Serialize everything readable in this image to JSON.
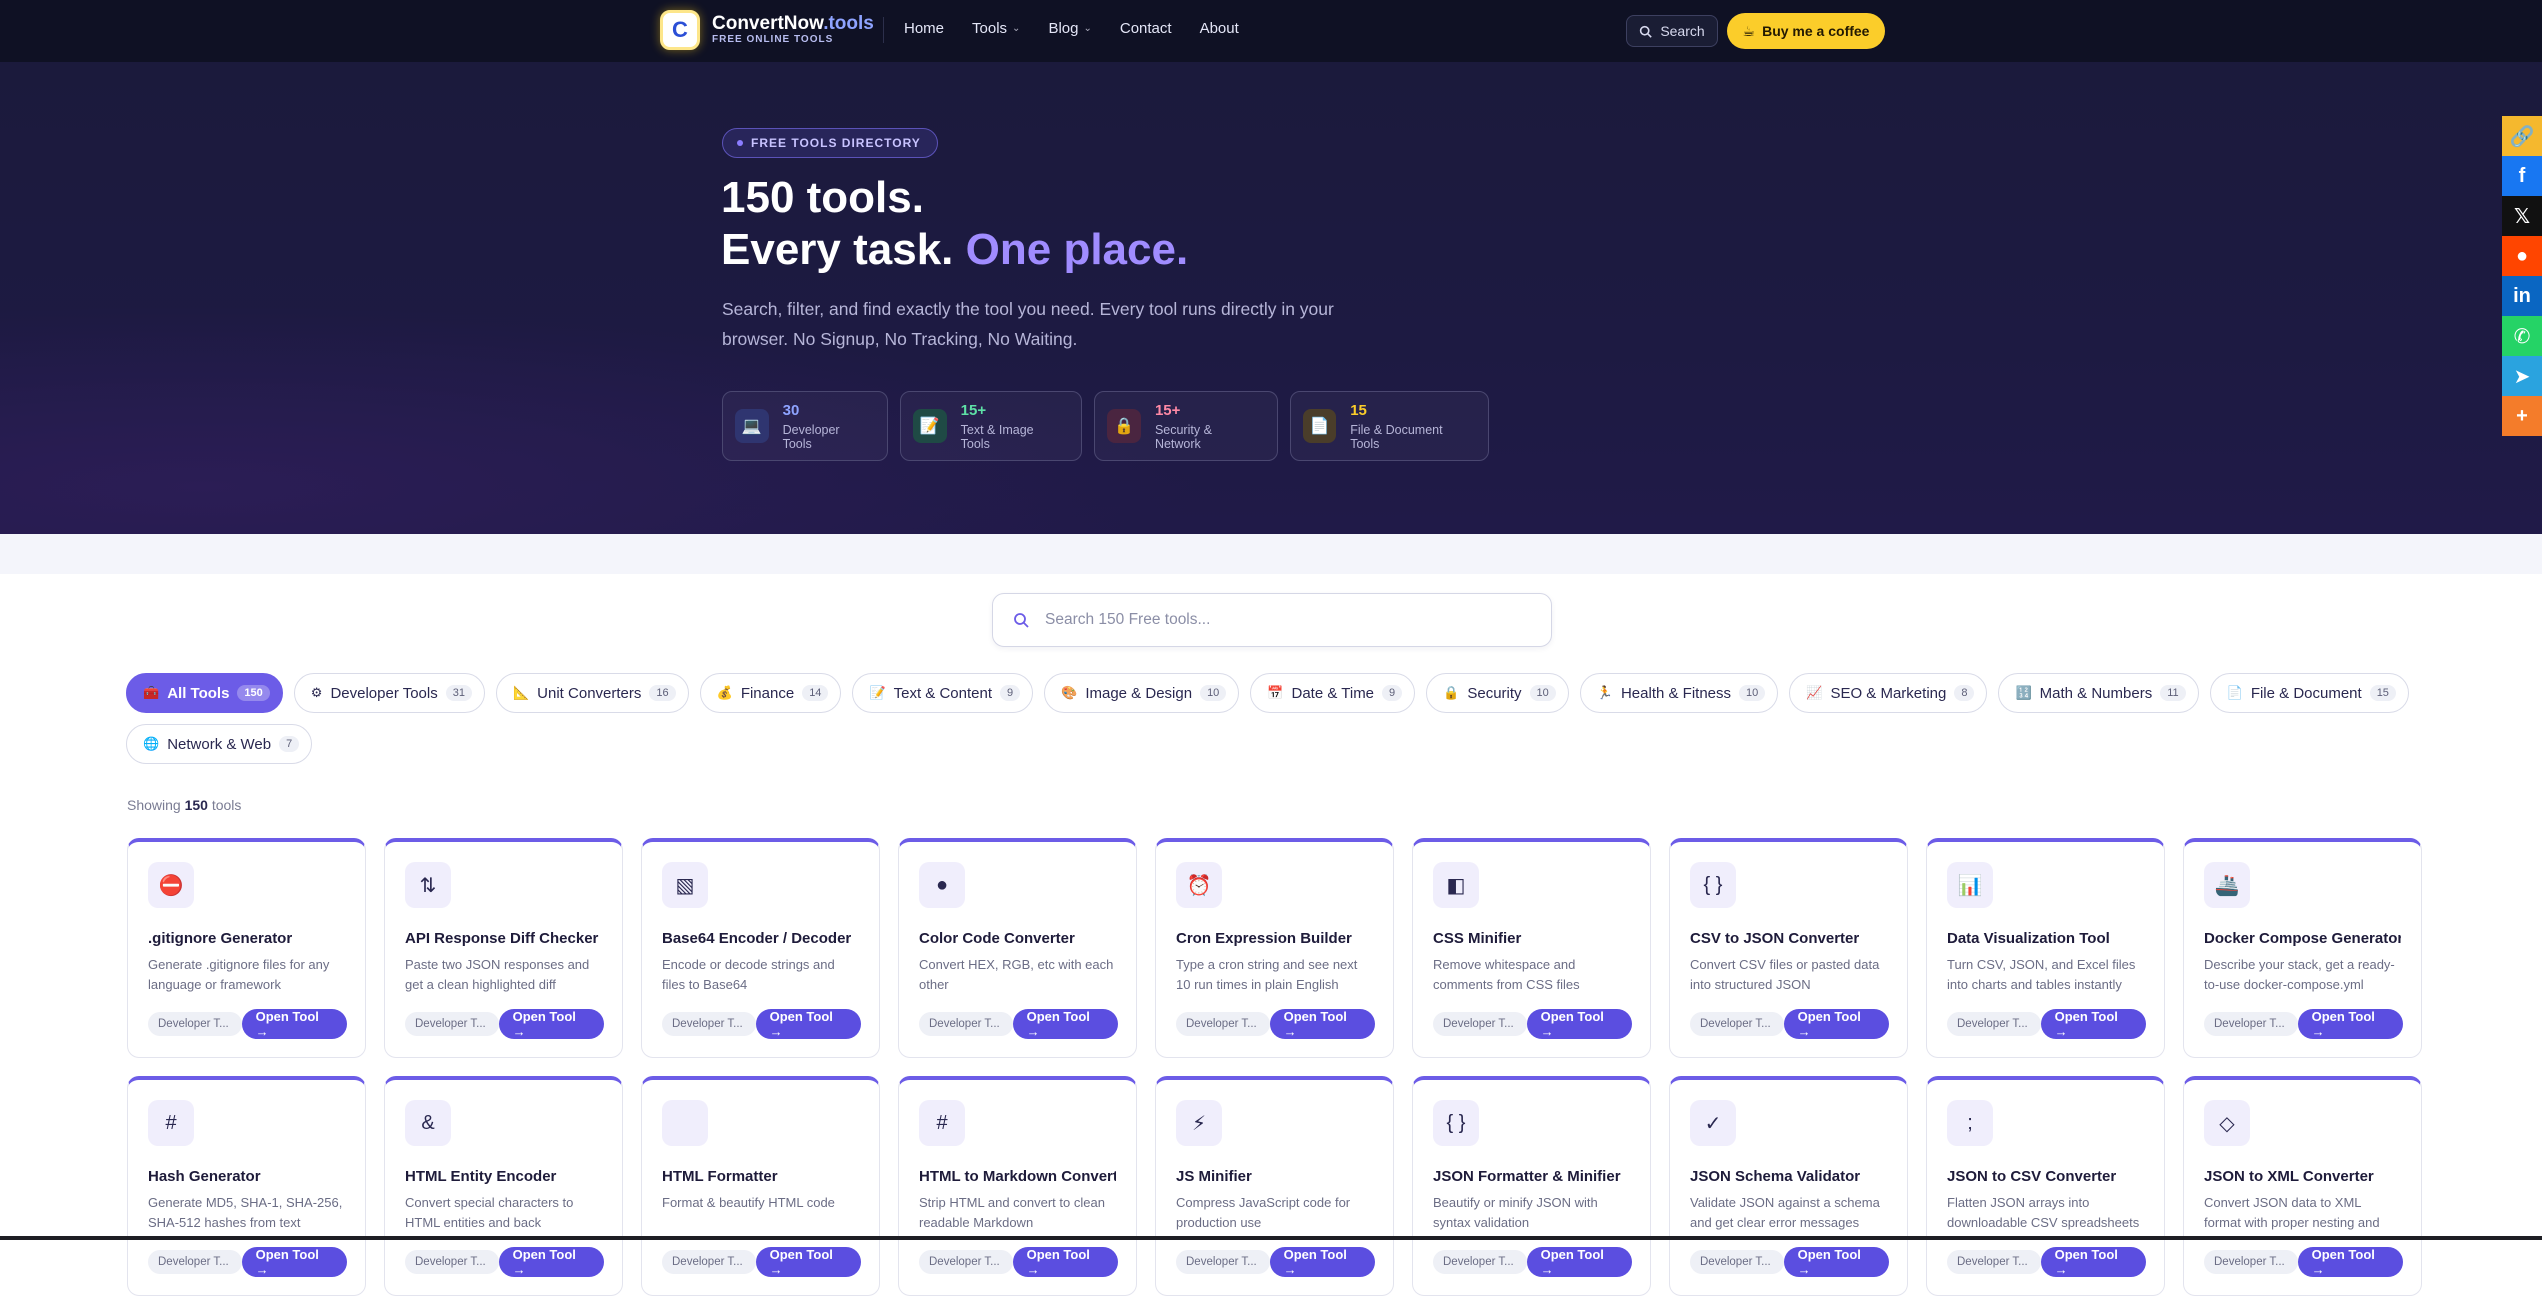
{
  "nav": {
    "brand_name": "ConvertNow",
    "brand_tld": ".tools",
    "brand_sub": "FREE ONLINE TOOLS",
    "logo_letter": "C",
    "links": [
      {
        "label": "Home"
      },
      {
        "label": "Tools",
        "dropdown": true
      },
      {
        "label": "Blog",
        "dropdown": true
      },
      {
        "label": "Contact"
      },
      {
        "label": "About"
      }
    ],
    "search_label": "Search",
    "coffee_label": "Buy me a coffee"
  },
  "hero": {
    "badge": "FREE TOOLS DIRECTORY",
    "title_line1": "150 tools.",
    "title_line2_plain": "Every task.",
    "title_line2_accent": "One place.",
    "description": "Search, filter, and find exactly the tool you need. Every tool runs directly in your browser. No Signup, No Tracking, No Waiting.",
    "stats": [
      {
        "number": "30",
        "label": "Developer Tools",
        "icon": "💻",
        "color": "#8ea3ff",
        "bg": "#2f3570"
      },
      {
        "number": "15+",
        "label": "Text & Image Tools",
        "icon": "📝",
        "color": "#5ee1a6",
        "bg": "#1f4a45"
      },
      {
        "number": "15+",
        "label": "Security & Network",
        "icon": "🔒",
        "color": "#ff8aa6",
        "bg": "#4a2540"
      },
      {
        "number": "15",
        "label": "File & Document Tools",
        "icon": "📄",
        "color": "#fbcd2a",
        "bg": "#4a3d2a"
      }
    ]
  },
  "share": [
    {
      "icon": "link-icon",
      "glyph": "🔗",
      "color": "#f5b82e"
    },
    {
      "icon": "facebook-icon",
      "glyph": "f",
      "color": "#1877f2"
    },
    {
      "icon": "x-icon",
      "glyph": "𝕏",
      "color": "#111111"
    },
    {
      "icon": "reddit-icon",
      "glyph": "●",
      "color": "#ff4500"
    },
    {
      "icon": "linkedin-icon",
      "glyph": "in",
      "color": "#0a66c2"
    },
    {
      "icon": "whatsapp-icon",
      "glyph": "✆",
      "color": "#25d366"
    },
    {
      "icon": "telegram-icon",
      "glyph": "➤",
      "color": "#2aa3df"
    },
    {
      "icon": "more-icon",
      "glyph": "+",
      "color": "#f47c2a"
    }
  ],
  "search": {
    "placeholder": "Search 150 Free tools..."
  },
  "filters": [
    {
      "label": "All Tools",
      "count": "150",
      "icon": "🧰",
      "active": true
    },
    {
      "label": "Developer Tools",
      "count": "31",
      "icon": "⚙"
    },
    {
      "label": "Unit Converters",
      "count": "16",
      "icon": "📐"
    },
    {
      "label": "Finance",
      "count": "14",
      "icon": "💰"
    },
    {
      "label": "Text & Content",
      "count": "9",
      "icon": "📝"
    },
    {
      "label": "Image & Design",
      "count": "10",
      "icon": "🎨"
    },
    {
      "label": "Date & Time",
      "count": "9",
      "icon": "📅"
    },
    {
      "label": "Security",
      "count": "10",
      "icon": "🔒"
    },
    {
      "label": "Health & Fitness",
      "count": "10",
      "icon": "🏃"
    },
    {
      "label": "SEO & Marketing",
      "count": "8",
      "icon": "📈"
    },
    {
      "label": "Math & Numbers",
      "count": "11",
      "icon": "🔢"
    },
    {
      "label": "File & Document",
      "count": "15",
      "icon": "📄"
    },
    {
      "label": "Network & Web",
      "count": "7",
      "icon": "🌐"
    }
  ],
  "showing": {
    "prefix": "Showing",
    "count": "150",
    "suffix": "tools"
  },
  "cards": [
    {
      "icon": "⛔",
      "title": ".gitignore Generator",
      "desc": "Generate .gitignore files for any language or framework",
      "tag": "Developer T...",
      "cta": "Open Tool →"
    },
    {
      "icon": "⇅",
      "title": "API Response Diff Checker",
      "desc": "Paste two JSON responses and get a clean highlighted diff",
      "tag": "Developer T...",
      "cta": "Open Tool →"
    },
    {
      "icon": "▧",
      "title": "Base64 Encoder / Decoder",
      "desc": "Encode or decode strings and files to Base64",
      "tag": "Developer T...",
      "cta": "Open Tool →"
    },
    {
      "icon": "●",
      "title": "Color Code Converter",
      "desc": "Convert HEX, RGB, etc with each other",
      "tag": "Developer T...",
      "cta": "Open Tool →"
    },
    {
      "icon": "⏰",
      "title": "Cron Expression Builder",
      "desc": "Type a cron string and see next 10 run times in plain English",
      "tag": "Developer T...",
      "cta": "Open Tool →"
    },
    {
      "icon": "◧",
      "title": "CSS Minifier",
      "desc": "Remove whitespace and comments from CSS files",
      "tag": "Developer T...",
      "cta": "Open Tool →"
    },
    {
      "icon": "{ }",
      "title": "CSV to JSON Converter",
      "desc": "Convert CSV files or pasted data into structured JSON",
      "tag": "Developer T...",
      "cta": "Open Tool →"
    },
    {
      "icon": "📊",
      "title": "Data Visualization Tool",
      "desc": "Turn CSV, JSON, and Excel files into charts and tables instantly",
      "tag": "Developer T...",
      "cta": "Open Tool →"
    },
    {
      "icon": "🚢",
      "title": "Docker Compose Generator",
      "desc": "Describe your stack, get a ready-to-use docker-compose.yml",
      "tag": "Developer T...",
      "cta": "Open Tool →"
    },
    {
      "icon": "#",
      "title": "Hash Generator",
      "desc": "Generate MD5, SHA-1, SHA-256, SHA-512 hashes from text",
      "tag": "Developer T...",
      "cta": "Open Tool →"
    },
    {
      "icon": "&",
      "title": "HTML Entity Encoder",
      "desc": "Convert special characters to HTML entities and back",
      "tag": "Developer T...",
      "cta": "Open Tool →"
    },
    {
      "icon": "",
      "title": "HTML Formatter",
      "desc": "Format & beautify HTML code",
      "tag": "Developer T...",
      "cta": "Open Tool →"
    },
    {
      "icon": "#",
      "title": "HTML to Markdown Converter",
      "desc": "Strip HTML and convert to clean readable Markdown",
      "tag": "Developer T...",
      "cta": "Open Tool →"
    },
    {
      "icon": "⚡",
      "title": "JS Minifier",
      "desc": "Compress JavaScript code for production use",
      "tag": "Developer T...",
      "cta": "Open Tool →"
    },
    {
      "icon": "{ }",
      "title": "JSON Formatter & Minifier",
      "desc": "Beautify or minify JSON with syntax validation",
      "tag": "Developer T...",
      "cta": "Open Tool →"
    },
    {
      "icon": "✓",
      "title": "JSON Schema Validator",
      "desc": "Validate JSON against a schema and get clear error messages",
      "tag": "Developer T...",
      "cta": "Open Tool →"
    },
    {
      "icon": ";",
      "title": "JSON to CSV Converter",
      "desc": "Flatten JSON arrays into downloadable CSV spreadsheets",
      "tag": "Developer T...",
      "cta": "Open Tool →"
    },
    {
      "icon": "◇",
      "title": "JSON to XML Converter",
      "desc": "Convert JSON data to XML format with proper nesting and attributes",
      "tag": "Developer T...",
      "cta": "Open Tool →"
    }
  ]
}
